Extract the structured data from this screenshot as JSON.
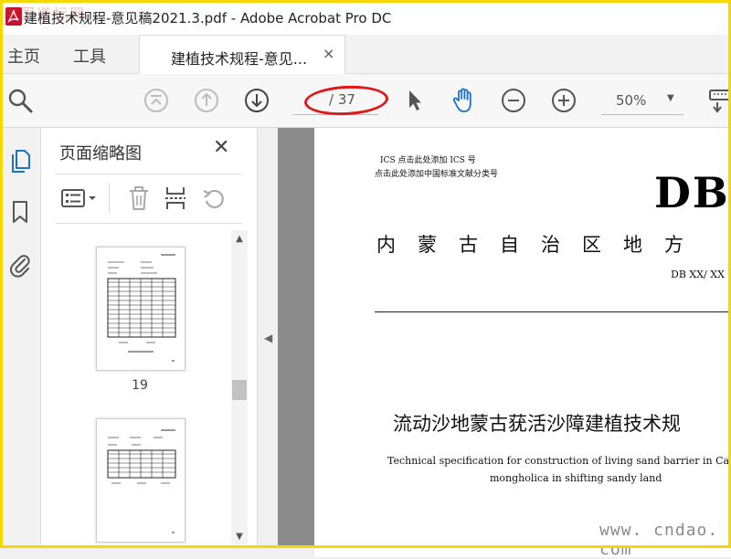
{
  "window": {
    "title": "建植技术规程-意见稿2021.3.pdf - Adobe Acrobat Pro DC",
    "watermark_top": "中国道标网"
  },
  "nav_tabs": {
    "home": "主页",
    "tools": "工具"
  },
  "doc_tab": {
    "label": "建植技术规程-意见...",
    "close": "×"
  },
  "toolbar": {
    "page_current": "",
    "page_total": "/ 37",
    "zoom": "50%",
    "highlight_color": "#e01818"
  },
  "thumbnails_panel": {
    "title": "页面缩略图",
    "close": "✕",
    "thumbs": [
      {
        "page": "19"
      },
      {
        "page": ""
      }
    ]
  },
  "document": {
    "ics_line": "ICS   点击此处添加 ICS 号",
    "class_line": "点击此处添加中国标准文献分类号",
    "db_mark": "DB",
    "region_heading": "内蒙古自治区地方",
    "db_number": "DB XX/  XX",
    "cn_title": "流动沙地蒙古莸活沙障建植技术规",
    "en_title_line1": "Technical specification for construction of living sand barrier in Caryo",
    "en_title_line2": "mongholica in shifting sandy land"
  },
  "site_watermark": "www. cndao. com",
  "colors": {
    "frame": "#f5d800",
    "active_blue": "#1a73c8"
  }
}
